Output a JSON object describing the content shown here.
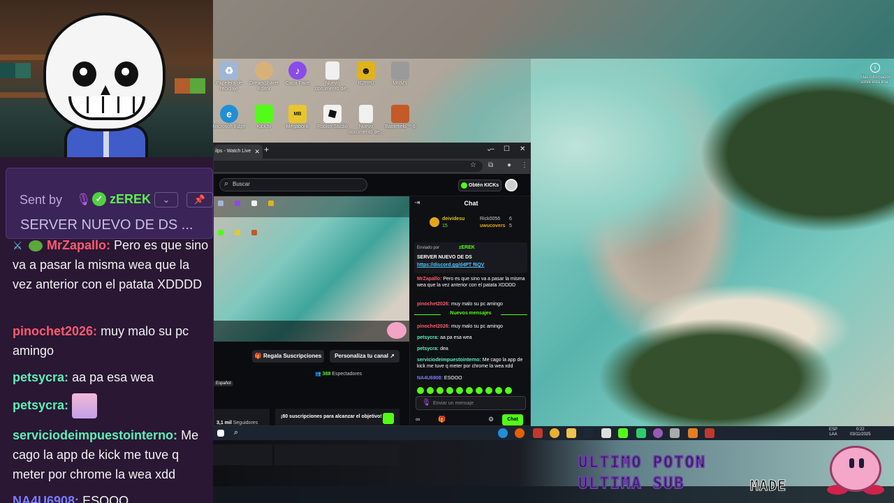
{
  "stream_chat": {
    "pinned": {
      "sent_by_label": "Sent by",
      "sender": "zEREK",
      "message": "SERVER NUEVO DE DS ..."
    },
    "messages": [
      {
        "user": "MrZapallo:",
        "user_color": "#ff5a6e",
        "text": "Pero es que sino va a pasar la misma wea que la vez anterior con el patata XDDDD"
      },
      {
        "user": "pinochet2026:",
        "user_color": "#ff5a6e",
        "text": "muy malo su pc amingo"
      },
      {
        "user": "petsycra:",
        "user_color": "#5cf0b8",
        "text": "aa pa esa wea"
      },
      {
        "user": "petsycra:",
        "user_color": "#5cf0b8",
        "text": ""
      },
      {
        "user": "serviciodeimpuestointerno:",
        "user_color": "#5cf0b8",
        "text": "Me cago la app de kick me tuve q meter por chrome la wea xdd"
      },
      {
        "user": "NA4U6908:",
        "user_color": "#7a7cff",
        "text": "ESOOO"
      }
    ]
  },
  "desktop": {
    "icons_row1": [
      {
        "label": "Papelera de reciclaje",
        "icon": "recycle-bin-icon",
        "color": "#9fb6d8"
      },
      {
        "label": "DreamSharet Editor",
        "icon": "app-icon",
        "color": "#d6b27a"
      },
      {
        "label": "Carpi Face",
        "icon": "podcast-icon",
        "color": "#8a4be8"
      },
      {
        "label": "Nuevo documento de...",
        "icon": "document-icon",
        "color": "#f0f0f0"
      },
      {
        "label": "R2PPU",
        "icon": "game-icon",
        "color": "#e0b21c"
      },
      {
        "label": "MRMY",
        "icon": "game-icon",
        "color": "#9a9a9a"
      }
    ],
    "icons_row2": [
      {
        "label": "Microsoft Edge",
        "icon": "edge-icon",
        "color": "#1f8fd6"
      },
      {
        "label": "Kick.tv",
        "icon": "kick-icon",
        "color": "#53fc18"
      },
      {
        "label": "Megabonk",
        "icon": "game-icon",
        "color": "#e8c62c"
      },
      {
        "label": "Roblox Studio",
        "icon": "roblox-icon",
        "color": "#f2f2f2"
      },
      {
        "label": "Nuevo documento de...",
        "icon": "document-icon",
        "color": "#f0f0f0"
      },
      {
        "label": "Battlefield™ 6",
        "icon": "game-icon",
        "color": "#c25a2a"
      }
    ],
    "info_text": "Más información sobre esta ima..."
  },
  "browser": {
    "tab_title": "ilps - Watch Live",
    "kick": {
      "search_placeholder": "Buscar",
      "get_kicks": "Obtén KICKs",
      "gift_subs": "Regala Suscripciones",
      "customize": "Personaliza tu canal",
      "viewers_count": "388",
      "viewers_label": "Espectadores",
      "language": "Español",
      "followers_count": "3,1 mil",
      "followers_label": "Seguidores",
      "goal_text": "¡80 suscripciones para alcanzar el objetivo!"
    },
    "chat": {
      "title": "Chat",
      "leaderboard": [
        {
          "name": "deividesu",
          "value": "15"
        },
        {
          "name": "Rick0056",
          "value": "6"
        },
        {
          "name": "uwucovers",
          "value": "5"
        }
      ],
      "pinned_by_label": "Enviado por",
      "pinned_by": "zEREK",
      "pinned_title": "SERVER NUEVO DE DS",
      "pinned_link": "https://discord.gg/d4PT f6QV",
      "messages": [
        {
          "user": "MrZapallo:",
          "color": "#ff5a6e",
          "text": "Pero es que sino va a pasar la misma wea que la vez anterior con el patata XDDDD"
        },
        {
          "user": "pinochet2026:",
          "color": "#ff5a6e",
          "text": "muy malo su pc amingo"
        }
      ],
      "new_messages_label": "Nuevos mensajes",
      "messages_after": [
        {
          "user": "pinochet2026:",
          "color": "#ff5a6e",
          "text": "muy malo su pc amingo"
        },
        {
          "user": "petsycra:",
          "color": "#5cf0b8",
          "text": "aa pa esa wea"
        },
        {
          "user": "petsycra:",
          "color": "#5cf0b8",
          "text": "dea"
        },
        {
          "user": "serviciodeimpuestointerno:",
          "color": "#5cf0b8",
          "text": "Me cago la app de kick me tuve q meter por chrome la wea xdd"
        },
        {
          "user": "NA4U6908:",
          "color": "#7a7cff",
          "text": "ESOOO"
        }
      ],
      "send_placeholder": "Enviar un mensaje",
      "send_button": "Chat"
    }
  },
  "taskbar": {
    "lang": "ESP",
    "lang2": "LAA",
    "time": "0:22",
    "date": "03/11/2025"
  },
  "overlay": {
    "line1": "ULTIMO POTON",
    "line2": "ULTIMA SUB",
    "tag": "MADE"
  },
  "colors": {
    "kick_green": "#53fc18",
    "chat_bg": "#2a1733",
    "pinned_bg": "#3b2457"
  }
}
